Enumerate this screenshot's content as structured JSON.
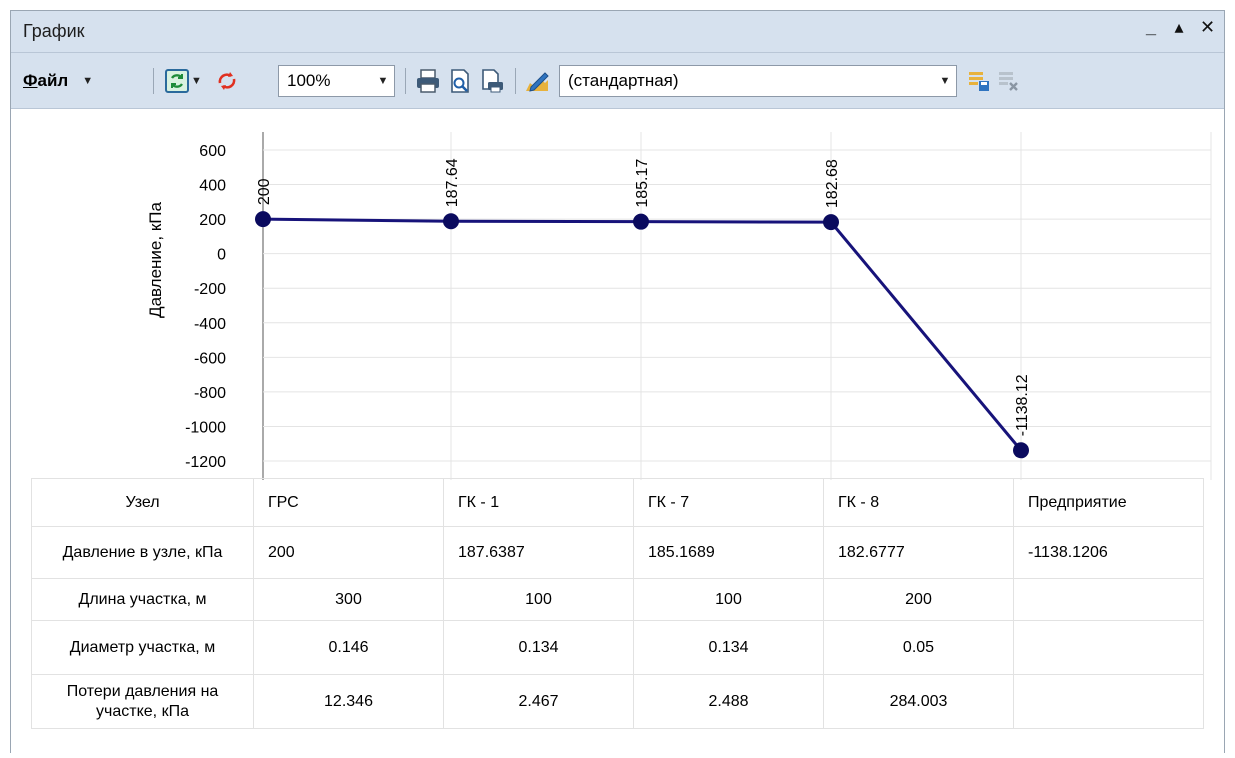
{
  "window": {
    "title": "График",
    "minimize": "_",
    "restore": "▴",
    "close": "✕"
  },
  "toolbar": {
    "file_label": "Файл",
    "file_accesskey": "Ф",
    "file_rest": "айл",
    "zoom": "100%",
    "scheme": "(стандартная)",
    "icons": [
      "refresh-icon",
      "reload-icon",
      "print-icon",
      "print-preview-icon",
      "print-setup-icon",
      "edit-scheme-icon",
      "save-scheme-icon",
      "delete-scheme-icon"
    ]
  },
  "chart_data": {
    "type": "line",
    "ylabel": "Давление, кПа",
    "ylim": [
      -1200,
      600
    ],
    "yticks": [
      600,
      400,
      200,
      0,
      -200,
      -400,
      -600,
      -800,
      -1000,
      -1200
    ],
    "categories": [
      "ГРС",
      "ГК - 1",
      "ГК - 7",
      "ГК - 8",
      "Предприятие"
    ],
    "point_labels": [
      "200",
      "187.64",
      "185.17",
      "182.68",
      "-1138.12"
    ],
    "values": [
      200,
      187.64,
      185.17,
      182.68,
      -1138.12
    ],
    "grid": true,
    "colors": {
      "line": "#17137a",
      "marker": "#0a0a5e",
      "grid": "#e4e4e4"
    }
  },
  "table": {
    "rows": [
      {
        "header": "Узел",
        "cells": [
          "ГРС",
          "ГК - 1",
          "ГК - 7",
          "ГК - 8",
          "Предприятие"
        ]
      },
      {
        "header": "Давление в узле, кПа",
        "cells": [
          "200",
          "187.6387",
          "185.1689",
          "182.6777",
          "-1138.1206"
        ]
      },
      {
        "header": "Длина участка, м",
        "cells": [
          "300",
          "100",
          "100",
          "200",
          ""
        ]
      },
      {
        "header": "Диаметр участка, м",
        "cells": [
          "0.146",
          "0.134",
          "0.134",
          "0.05",
          ""
        ]
      },
      {
        "header": "Потери давления на участке, кПа",
        "cells": [
          "12.346",
          "2.467",
          "2.488",
          "284.003",
          ""
        ]
      }
    ]
  }
}
